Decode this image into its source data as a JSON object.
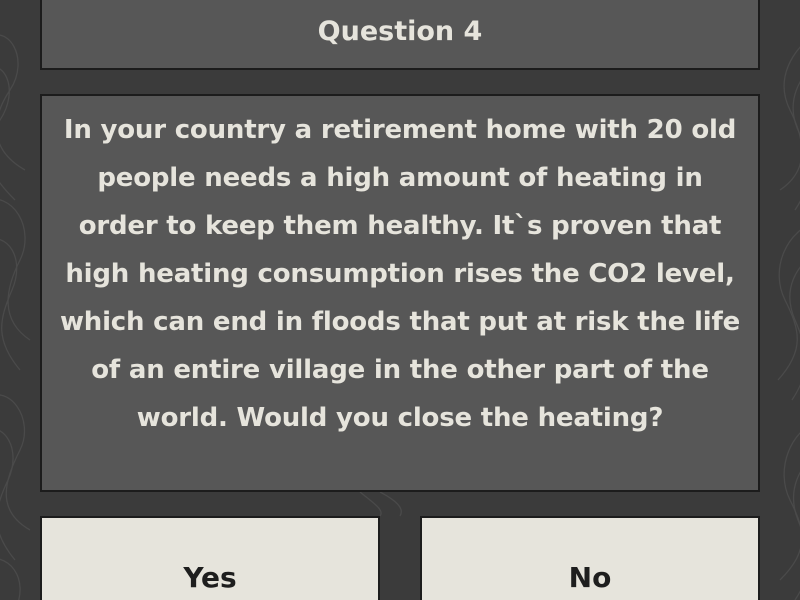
{
  "quiz": {
    "title": "Question 4",
    "question": "In your country a retirement home with 20 old people needs a high amount of heating in order to keep them healthy. It`s proven that high heating consumption rises the CO2 level, which can end in floods that put at risk the life of an entire village in the other part of the world. Would you close the heating?",
    "answers": [
      {
        "label": "Yes"
      },
      {
        "label": "No"
      }
    ]
  },
  "colors": {
    "background": "#3b3b3b",
    "panel": "#575757",
    "panel_text": "#e6e4dc",
    "button": "#e6e4dc",
    "button_text": "#1e1e1e",
    "border": "#1c1c1c"
  }
}
